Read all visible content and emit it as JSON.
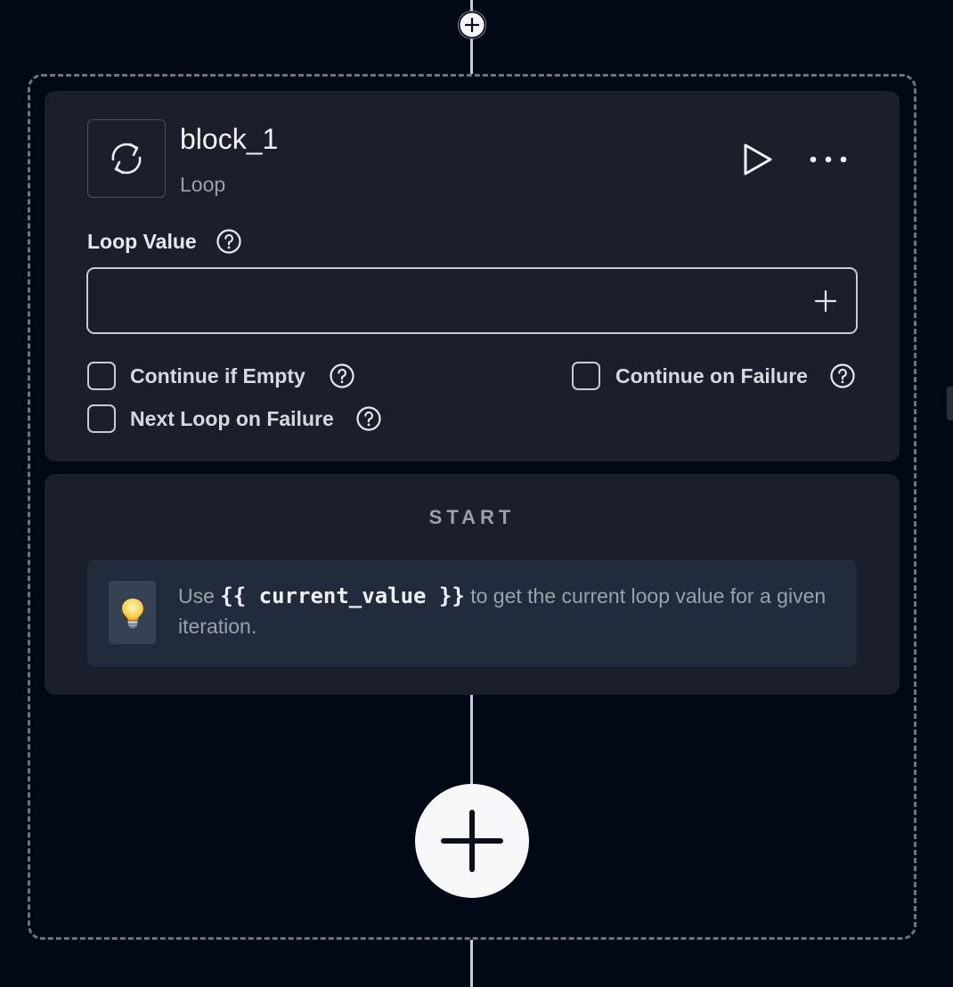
{
  "block": {
    "title": "block_1",
    "type": "Loop"
  },
  "loop_value": {
    "label": "Loop Value",
    "value": "",
    "placeholder": ""
  },
  "options": {
    "continue_if_empty": "Continue if Empty",
    "continue_on_failure": "Continue on Failure",
    "next_loop_on_failure": "Next Loop on Failure"
  },
  "start": {
    "label": "START",
    "tip_prefix": "Use ",
    "tip_code": "{{ current_value }}",
    "tip_suffix": " to get the current loop value for a given iteration."
  },
  "icons": {
    "block": "loop-arrows-icon",
    "run": "play-icon",
    "more": "more-horizontal-icon",
    "help": "help-circle-icon",
    "add": "plus-icon",
    "tip": "lightbulb-icon"
  },
  "colors": {
    "background": "#020816",
    "card": "#1b1e2b",
    "tip_background": "#222b3b",
    "border": "#c9ccd3",
    "dashed_frame": "#6b7280"
  }
}
